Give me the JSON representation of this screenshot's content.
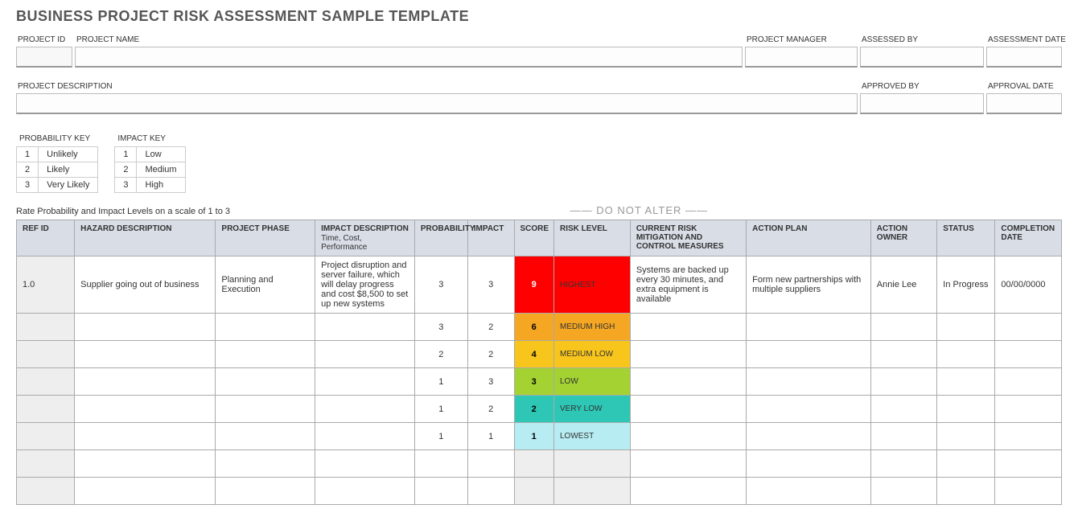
{
  "title": "BUSINESS PROJECT RISK ASSESSMENT SAMPLE TEMPLATE",
  "labels": {
    "project_id": "PROJECT ID",
    "project_name": "PROJECT NAME",
    "project_manager": "PROJECT MANAGER",
    "assessed_by": "ASSESSED BY",
    "assessment_date": "ASSESSMENT DATE",
    "project_description": "PROJECT DESCRIPTION",
    "approved_by": "APPROVED BY",
    "approval_date": "APPROVAL DATE",
    "probability_key": "PROBABILITY KEY",
    "impact_key": "IMPACT KEY",
    "rate_text": "Rate Probability and Impact Levels on a scale of 1 to 3",
    "do_not_alter": "——  DO NOT ALTER  ——"
  },
  "prob_key": [
    {
      "n": "1",
      "t": "Unlikely"
    },
    {
      "n": "2",
      "t": "Likely"
    },
    {
      "n": "3",
      "t": "Very Likely"
    }
  ],
  "impact_key": [
    {
      "n": "1",
      "t": "Low"
    },
    {
      "n": "2",
      "t": "Medium"
    },
    {
      "n": "3",
      "t": "High"
    }
  ],
  "headers": {
    "ref": "REF ID",
    "hazard": "HAZARD DESCRIPTION",
    "phase": "PROJECT PHASE",
    "impact": "IMPACT DESCRIPTION",
    "impact_sub": "Time, Cost, Performance",
    "prob": "PROBABILITY",
    "imp": "IMPACT",
    "score": "SCORE",
    "risk": "RISK LEVEL",
    "mit": "CURRENT RISK MITIGATION AND CONTROL MEASURES",
    "plan": "ACTION PLAN",
    "owner": "ACTION OWNER",
    "status": "STATUS",
    "comp": "COMPLETION DATE"
  },
  "rows": [
    {
      "ref": "1.0",
      "hazard": "Supplier going out of business",
      "phase": "Planning and Execution",
      "impact": "Project disruption and server failure, which will delay progress and cost $8,500 to set up new systems",
      "prob": "3",
      "imp": "3",
      "score": "9",
      "risk": "HIGHEST",
      "score_bg": "#ff0000",
      "score_color": "#fff",
      "risk_bg": "#ff0000",
      "mit": "Systems are backed up every 30 minutes, and extra equipment is available",
      "plan": "Form new partnerships with multiple suppliers",
      "owner": "Annie Lee",
      "status": "In Progress",
      "comp": "00/00/0000"
    },
    {
      "ref": "",
      "hazard": "",
      "phase": "",
      "impact": "",
      "prob": "3",
      "imp": "2",
      "score": "6",
      "risk": "MEDIUM HIGH",
      "score_bg": "#f5a623",
      "score_color": "#000",
      "risk_bg": "#f5a623",
      "mit": "",
      "plan": "",
      "owner": "",
      "status": "",
      "comp": ""
    },
    {
      "ref": "",
      "hazard": "",
      "phase": "",
      "impact": "",
      "prob": "2",
      "imp": "2",
      "score": "4",
      "risk": "MEDIUM LOW",
      "score_bg": "#f8c51c",
      "score_color": "#000",
      "risk_bg": "#f8c51c",
      "mit": "",
      "plan": "",
      "owner": "",
      "status": "",
      "comp": ""
    },
    {
      "ref": "",
      "hazard": "",
      "phase": "",
      "impact": "",
      "prob": "1",
      "imp": "3",
      "score": "3",
      "risk": "LOW",
      "score_bg": "#a4d233",
      "score_color": "#000",
      "risk_bg": "#a4d233",
      "mit": "",
      "plan": "",
      "owner": "",
      "status": "",
      "comp": ""
    },
    {
      "ref": "",
      "hazard": "",
      "phase": "",
      "impact": "",
      "prob": "1",
      "imp": "2",
      "score": "2",
      "risk": "VERY LOW",
      "score_bg": "#2ec7b5",
      "score_color": "#000",
      "risk_bg": "#2ec7b5",
      "mit": "",
      "plan": "",
      "owner": "",
      "status": "",
      "comp": ""
    },
    {
      "ref": "",
      "hazard": "",
      "phase": "",
      "impact": "",
      "prob": "1",
      "imp": "1",
      "score": "1",
      "risk": "LOWEST",
      "score_bg": "#b7ecf2",
      "score_color": "#000",
      "risk_bg": "#b7ecf2",
      "mit": "",
      "plan": "",
      "owner": "",
      "status": "",
      "comp": ""
    },
    {
      "ref": "",
      "hazard": "",
      "phase": "",
      "impact": "",
      "prob": "",
      "imp": "",
      "score": "",
      "risk": "",
      "score_bg": "#eee",
      "score_color": "#000",
      "risk_bg": "#eee",
      "mit": "",
      "plan": "",
      "owner": "",
      "status": "",
      "comp": ""
    },
    {
      "ref": "",
      "hazard": "",
      "phase": "",
      "impact": "",
      "prob": "",
      "imp": "",
      "score": "",
      "risk": "",
      "score_bg": "#eee",
      "score_color": "#000",
      "risk_bg": "#eee",
      "mit": "",
      "plan": "",
      "owner": "",
      "status": "",
      "comp": ""
    }
  ]
}
